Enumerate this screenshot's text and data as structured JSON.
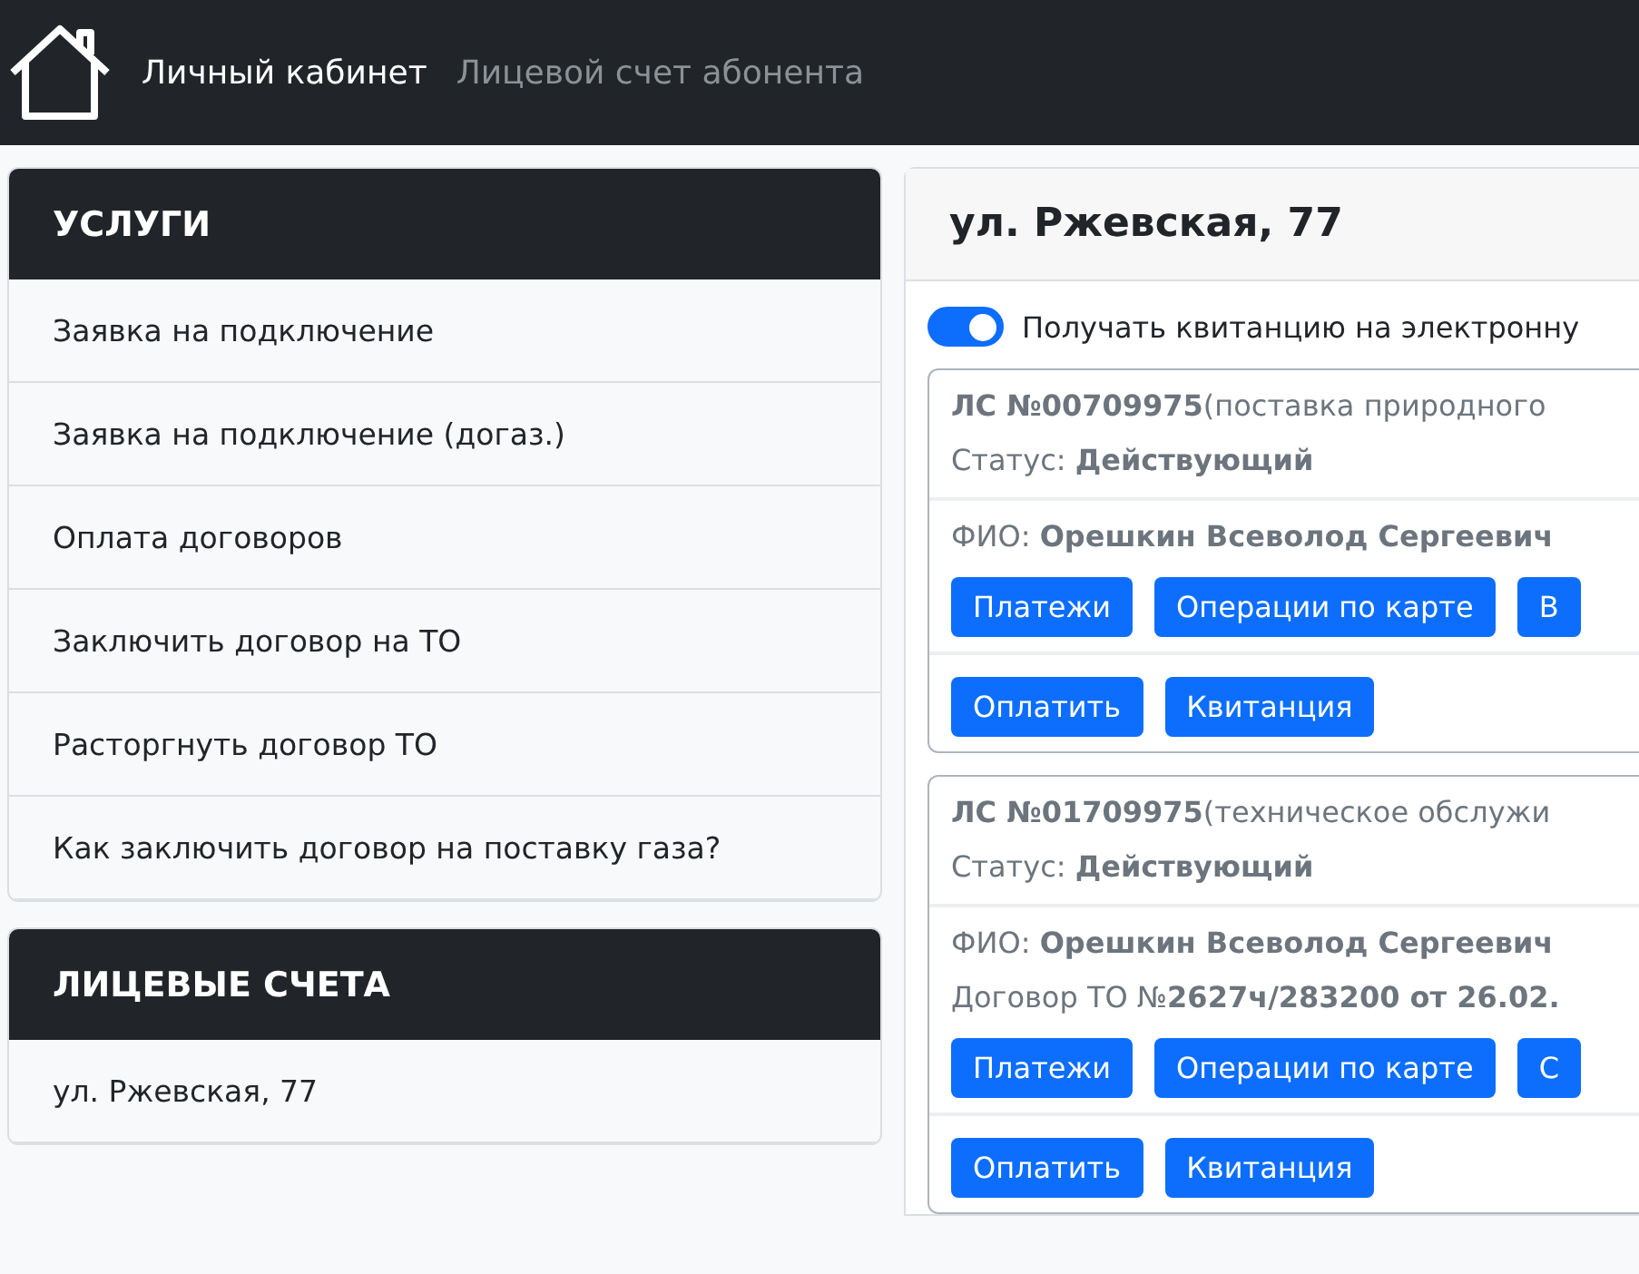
{
  "navbar": {
    "links": [
      {
        "label": "Личный кабинет",
        "selected": true
      },
      {
        "label": "Лицевой счет абонента",
        "selected": false
      }
    ]
  },
  "services": {
    "title": "УСЛУГИ",
    "items": [
      "Заявка на подключение",
      "Заявка на подключение (догаз.)",
      "Оплата договоров",
      "Заключить договор на ТО",
      "Расторгнуть договор ТО",
      "Как заключить договор на поставку газа?"
    ]
  },
  "accounts": {
    "title": "ЛИЦЕВЫЕ СЧЕТА",
    "items": [
      "ул. Ржевская, 77"
    ]
  },
  "address_panel": {
    "title": "ул. Ржевская, 77",
    "receipt_switch": {
      "label": "Получать квитанцию на электронну",
      "on": true
    },
    "account_cards": [
      {
        "heading": "**ЛС №00709975**(поставка природного",
        "status": "Статус: **Действующий**",
        "details": [
          "ФИО: **Орешкин Всеволод Сергеевич**"
        ],
        "buttons": [
          "Платежи",
          "Операции по карте",
          "В"
        ],
        "actions": [
          "Оплатить",
          "Квитанция"
        ]
      },
      {
        "heading": "**ЛС №01709975**(техническое обслужи",
        "status": "Статус: **Действующий**",
        "details": [
          "ФИО: **Орешкин Всеволод Сергеевич**",
          "Договор ТО №**2627ч/283200 от 26.02.**"
        ],
        "buttons": [
          "Платежи",
          "Операции по карте",
          "С"
        ],
        "actions": [
          "Оплатить",
          "Квитанция"
        ]
      }
    ]
  }
}
